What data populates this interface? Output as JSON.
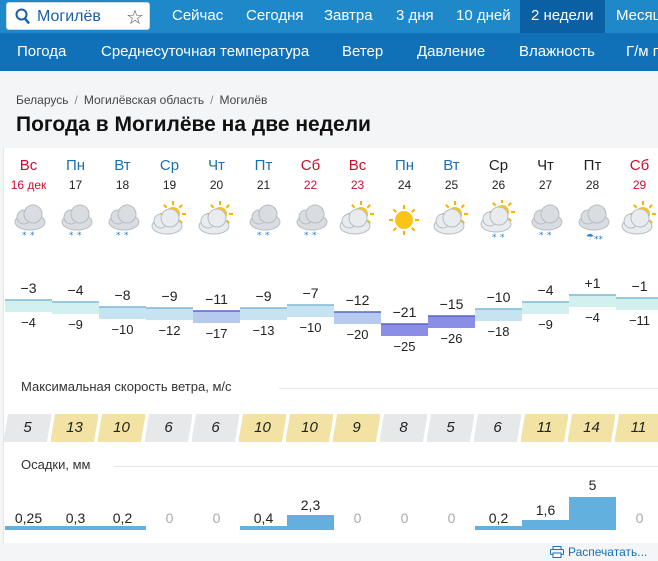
{
  "nav": {
    "search_value": "Могилёв",
    "items": [
      "Сейчас",
      "Сегодня",
      "Завтра",
      "3 дня",
      "10 дней",
      "2 недели",
      "Месяц"
    ],
    "active_index": 5,
    "sub_items": [
      "Погода",
      "Среднесуточная температура",
      "Ветер",
      "Давление",
      "Влажность",
      "Г/м п"
    ]
  },
  "breadcrumb": [
    "Беларусь",
    "Могилёвская область",
    "Могилёв"
  ],
  "page_title": "Погода в Могилёве на две недели",
  "days": [
    {
      "dow": "Вс",
      "date": "16 дек",
      "kind": "sun",
      "icon": "cloudy-snow-icon",
      "tmax": "−3",
      "tmin": "−4",
      "wind": "5",
      "precip": "0,25"
    },
    {
      "dow": "Пн",
      "date": "17",
      "kind": "wd",
      "icon": "cloudy-snow-icon",
      "tmax": "−4",
      "tmin": "−9",
      "wind": "13",
      "precip": "0,3"
    },
    {
      "dow": "Вт",
      "date": "18",
      "kind": "wd",
      "icon": "cloudy-snow-icon",
      "tmax": "−8",
      "tmin": "−10",
      "wind": "10",
      "precip": "0,2"
    },
    {
      "dow": "Ср",
      "date": "19",
      "kind": "wd",
      "icon": "partly-cloudy-icon",
      "tmax": "−9",
      "tmin": "−12",
      "wind": "6",
      "precip": "0"
    },
    {
      "dow": "Чт",
      "date": "20",
      "kind": "wd",
      "icon": "partly-cloudy-icon",
      "tmax": "−11",
      "tmin": "−17",
      "wind": "6",
      "precip": "0"
    },
    {
      "dow": "Пт",
      "date": "21",
      "kind": "wd",
      "icon": "cloudy-snow-icon",
      "tmax": "−9",
      "tmin": "−13",
      "wind": "10",
      "precip": "0,4"
    },
    {
      "dow": "Сб",
      "date": "22",
      "kind": "sat",
      "icon": "cloudy-snow-icon",
      "tmax": "−7",
      "tmin": "−10",
      "wind": "10",
      "precip": "2,3"
    },
    {
      "dow": "Вс",
      "date": "23",
      "kind": "sun",
      "icon": "partly-cloudy-icon",
      "tmax": "−12",
      "tmin": "−20",
      "wind": "9",
      "precip": "0"
    },
    {
      "dow": "Пн",
      "date": "24",
      "kind": "wd",
      "icon": "sun-icon",
      "tmax": "−21",
      "tmin": "−25",
      "wind": "8",
      "precip": "0"
    },
    {
      "dow": "Вт",
      "date": "25",
      "kind": "wd",
      "icon": "partly-cloudy-icon",
      "tmax": "−15",
      "tmin": "−26",
      "wind": "5",
      "precip": "0"
    },
    {
      "dow": "Ср",
      "date": "26",
      "kind": "blk",
      "icon": "partly-cloudy-snow-icon",
      "tmax": "−10",
      "tmin": "−18",
      "wind": "6",
      "precip": "0,2"
    },
    {
      "dow": "Чт",
      "date": "27",
      "kind": "blk",
      "icon": "cloudy-snow-icon",
      "tmax": "−4",
      "tmin": "−9",
      "wind": "11",
      "precip": "1,6"
    },
    {
      "dow": "Пт",
      "date": "28",
      "kind": "blk",
      "icon": "cloudy-sleet-icon",
      "tmax": "+1",
      "tmin": "−4",
      "wind": "14",
      "precip": "5"
    },
    {
      "dow": "Сб",
      "date": "29",
      "kind": "sat",
      "icon": "partly-cloudy-icon",
      "tmax": "−1",
      "tmin": "−11",
      "wind": "11",
      "precip": "0"
    }
  ],
  "wind_label": "Максимальная скорость ветра, м/с",
  "precip_label": "Осадки, мм",
  "print_label": "Распечатать...",
  "colors": {
    "nav": "#1e88c9",
    "subnav": "#1071b8",
    "active": "#0b5fa3",
    "warm_band": "#c8ecea",
    "cold_band": "#8a8ee6",
    "precip_bar": "#62b0de"
  }
}
